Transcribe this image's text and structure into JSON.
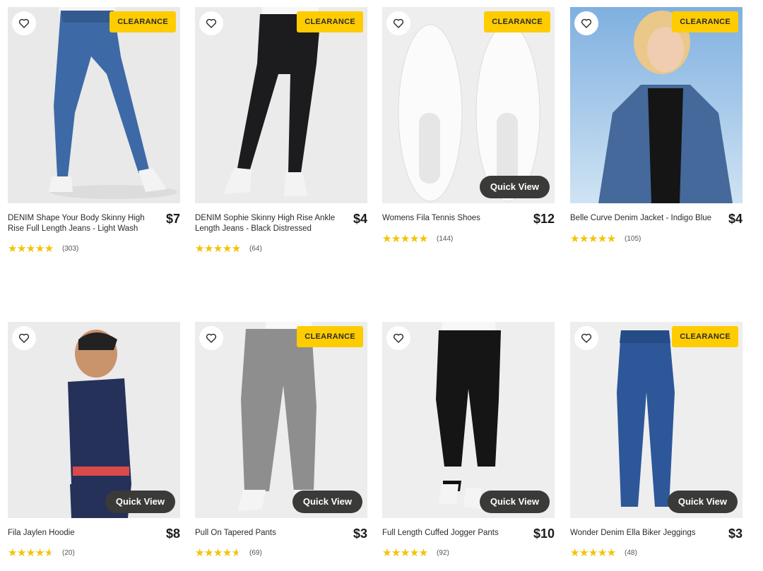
{
  "products": [
    {
      "title": "DENIM Shape Your Body Skinny High Rise Full Length Jeans - Light Wash",
      "price": "$7",
      "badge": "CLEARANCE",
      "quick_view": "",
      "rating": 4.5,
      "reviews": "(303)"
    },
    {
      "title": "DENIM Sophie Skinny High Rise Ankle Length Jeans - Black Distressed",
      "price": "$4",
      "badge": "CLEARANCE",
      "quick_view": "",
      "rating": 4.5,
      "reviews": "(64)"
    },
    {
      "title": "Womens Fila Tennis Shoes",
      "price": "$12",
      "badge": "CLEARANCE",
      "quick_view": "Quick View",
      "rating": 4.5,
      "reviews": "(144)"
    },
    {
      "title": "Belle Curve Denim Jacket - Indigo Blue",
      "price": "$4",
      "badge": "CLEARANCE",
      "quick_view": "",
      "rating": 4.5,
      "reviews": "(105)"
    },
    {
      "title": "Fila Jaylen Hoodie",
      "price": "$8",
      "badge": "",
      "quick_view": "Quick View",
      "rating": 4.0,
      "reviews": "(20)"
    },
    {
      "title": "Pull On Tapered Pants",
      "price": "$3",
      "badge": "CLEARANCE",
      "quick_view": "Quick View",
      "rating": 4.0,
      "reviews": "(69)"
    },
    {
      "title": "Full Length Cuffed Jogger Pants",
      "price": "$10",
      "badge": "",
      "quick_view": "Quick View",
      "rating": 4.5,
      "reviews": "(92)"
    },
    {
      "title": "Wonder Denim Ella Biker Jeggings",
      "price": "$3",
      "badge": "CLEARANCE",
      "quick_view": "Quick View",
      "rating": 4.5,
      "reviews": "(48)"
    }
  ],
  "icons": {
    "favorite": "heart-outline-icon",
    "rating": "star-icon"
  },
  "colors": {
    "badge": "#ffcc00",
    "quick_view_bg": "#3a3a38",
    "star": "#f5c400",
    "star_empty": "#dedede"
  }
}
